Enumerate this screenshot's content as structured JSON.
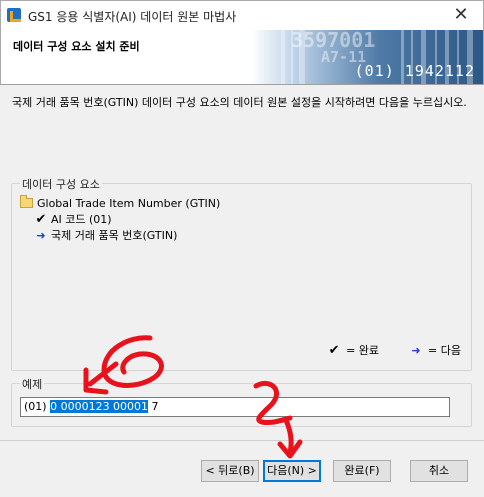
{
  "window": {
    "title": "GS1 응용 식별자(AI) 데이터 원본 마법사",
    "close_label": "✕"
  },
  "header": {
    "title": "데이터 구성 요소 설치 준비",
    "banner_number": "(01) 1942112",
    "banner_faint_1": "3597001",
    "banner_faint_2": "A7-11"
  },
  "instruction": "국제 거래 품목 번호(GTIN) 데이터 구성 요소의 데이터 원본 설정을 시작하려면 다음을 누르십시오.",
  "components": {
    "legend": "데이터 구성 요소",
    "tree": [
      {
        "label": "Global Trade Item Number (GTIN)",
        "icon": "folder-icon"
      },
      {
        "label": "AI 코드 (01)",
        "icon": "check-icon"
      },
      {
        "label": "국제 거래 품목 번호(GTIN)",
        "icon": "arrow-icon"
      }
    ],
    "key_done": "= 완료",
    "key_next": "= 다음"
  },
  "example": {
    "legend": "예제",
    "prefix": "(01) ",
    "selected": "0 0000123 00001",
    "suffix": " 7"
  },
  "buttons": {
    "back": "< 뒤로(B)",
    "next": "다음(N) >",
    "finish": "완료(F)",
    "cancel": "취소"
  },
  "annotations": {
    "step_1": "6",
    "step_2": "2"
  },
  "colors": {
    "selection": "#0078d7",
    "annotation": "#e8121c",
    "next_arrow": "#1b3fd3"
  }
}
